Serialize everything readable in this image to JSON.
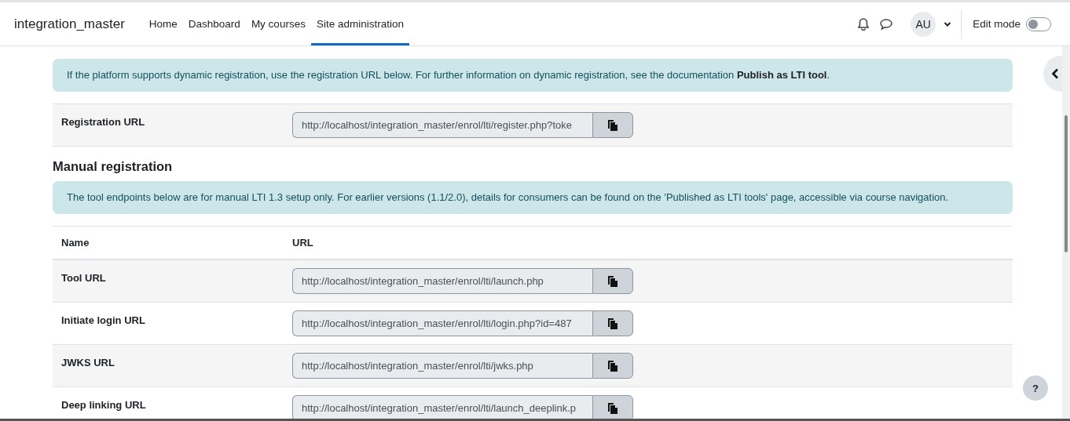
{
  "navbar": {
    "site_name": "integration_master",
    "items": [
      {
        "label": "Home",
        "selected": false
      },
      {
        "label": "Dashboard",
        "selected": false
      },
      {
        "label": "My courses",
        "selected": false
      },
      {
        "label": "Site administration",
        "selected": true
      }
    ],
    "user_initials": "AU",
    "edit_mode": {
      "label": "Edit mode",
      "on": false
    }
  },
  "dynamic_registration": {
    "notice": "If the platform supports dynamic registration, use the registration URL below. For further information on dynamic registration, see the documentation **Publish as LTI tool**.",
    "rows": [
      {
        "name": "Registration URL",
        "url": "http://localhost/integration_master/enrol/lti/register.php?toke"
      }
    ]
  },
  "manual_registration": {
    "heading": "Manual registration",
    "notice": "The tool endpoints below are for manual LTI 1.3 setup only. For earlier versions (1.1/2.0), details for consumers can be found on the 'Published as LTI tools' page, accessible via course navigation.",
    "columns": [
      "Name",
      "URL"
    ],
    "rows": [
      {
        "name": "Tool URL",
        "url": "http://localhost/integration_master/enrol/lti/launch.php"
      },
      {
        "name": "Initiate login URL",
        "url": "http://localhost/integration_master/enrol/lti/login.php?id=487"
      },
      {
        "name": "JWKS URL",
        "url": "http://localhost/integration_master/enrol/lti/jwks.php"
      },
      {
        "name": "Deep linking URL",
        "url": "http://localhost/integration_master/enrol/lti/launch_deeplink.p"
      }
    ]
  },
  "help_button": "?"
}
